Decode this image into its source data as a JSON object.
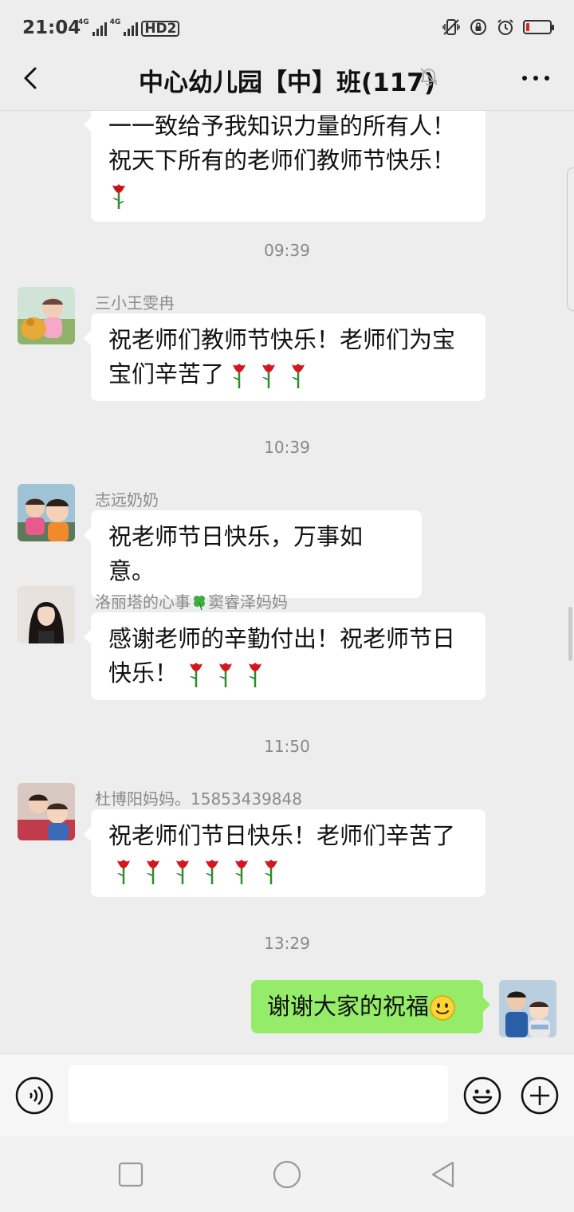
{
  "status_bar": {
    "time": "21:04",
    "net1_tag": "4G",
    "net2_tag": "4G",
    "hd_label": "HD2",
    "battery_level": 0.15,
    "battery_color": "#e02020"
  },
  "header": {
    "title": "中心幼儿园【中】班(117)",
    "back_icon": "chevron-left-icon",
    "mute_icon": "bell-off-icon",
    "more_icon": "more-dots-icon"
  },
  "messages": {
    "partial": {
      "line1": "一一致给予我知识力量的所有人！",
      "line2": "祝天下所有的老师们教师节快乐！"
    },
    "ts1": "09:39",
    "m1": {
      "sender": "三小王雯冉",
      "text": "祝老师们教师节快乐！老师们为宝宝们辛苦了"
    },
    "ts2": "10:39",
    "m2": {
      "sender": "志远奶奶",
      "text": "祝老师节日快乐，万事如意。"
    },
    "m3": {
      "sender_a": "洛丽塔的心事",
      "sender_b": "窦睿泽妈妈",
      "text": "感谢老师的辛勤付出！祝老师节日快乐！"
    },
    "ts3": "11:50",
    "m4": {
      "sender": "杜博阳妈妈。15853439848",
      "text": "祝老师们节日快乐！老师们辛苦了"
    },
    "ts4": "13:29",
    "m5": {
      "text": "谢谢大家的祝福"
    }
  },
  "input_bar": {
    "voice_icon": "voice-icon",
    "emoji_icon": "emoji-icon",
    "plus_icon": "plus-icon"
  },
  "colors": {
    "self_bubble": "#95ec69",
    "other_bubble": "#ffffff",
    "background": "#ededed"
  }
}
